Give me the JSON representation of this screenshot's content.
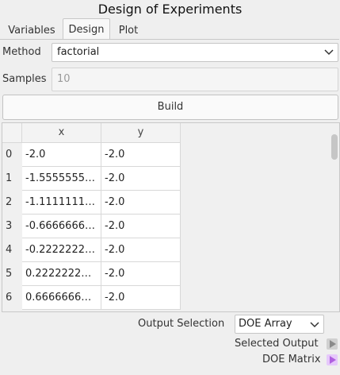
{
  "window": {
    "title": "Design of Experiments"
  },
  "tabs": [
    {
      "label": "Variables",
      "active": false
    },
    {
      "label": "Design",
      "active": true
    },
    {
      "label": "Plot",
      "active": false
    }
  ],
  "design": {
    "method_label": "Method",
    "method_value": "factorial",
    "samples_label": "Samples",
    "samples_value": "10",
    "build_label": "Build"
  },
  "table": {
    "columns": [
      "x",
      "y"
    ],
    "rows": [
      {
        "index": "0",
        "x": "-2.0",
        "y": "-2.0"
      },
      {
        "index": "1",
        "x": "-1.5555555…",
        "y": "-2.0"
      },
      {
        "index": "2",
        "x": "-1.1111111…",
        "y": "-2.0"
      },
      {
        "index": "3",
        "x": "-0.6666666…",
        "y": "-2.0"
      },
      {
        "index": "4",
        "x": "-0.2222222…",
        "y": "-2.0"
      },
      {
        "index": "5",
        "x": "0.2222222…",
        "y": "-2.0"
      },
      {
        "index": "6",
        "x": "0.6666666…",
        "y": "-2.0"
      }
    ]
  },
  "output": {
    "selection_label": "Output Selection",
    "selection_value": "DOE Array",
    "selected_output_label": "Selected Output",
    "doe_matrix_label": "DOE Matrix",
    "selected_output_color": "#a0a0a0",
    "doe_matrix_color": "#c080f0"
  }
}
